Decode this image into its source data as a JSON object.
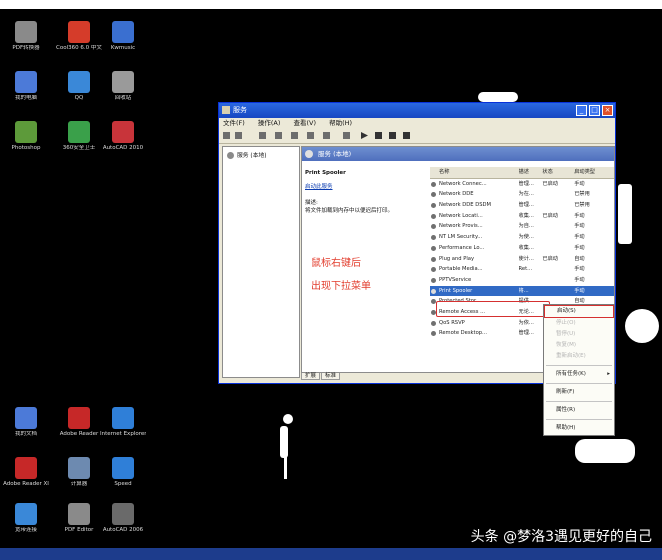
{
  "desktop_icons": [
    {
      "label": "PDF转换器",
      "color": "#8a8a8a"
    },
    {
      "label": "Cool360 6.0 中文版",
      "color": "#d53c2a"
    },
    {
      "label": "Kwmusic",
      "color": "#3a6fd0"
    },
    {
      "label": "我的电脑",
      "color": "#4c7ad8"
    },
    {
      "label": "QQ",
      "color": "#3a88d8"
    },
    {
      "label": "回收站",
      "color": "#9a9a9a"
    },
    {
      "label": "Photoshop",
      "color": "#5d9a3a"
    },
    {
      "label": "360安全卫士",
      "color": "#3aa04a"
    },
    {
      "label": "AutoCAD 2010",
      "color": "#c8343a"
    },
    {
      "label": "我的文档",
      "color": "#4c7ad8"
    },
    {
      "label": "Adobe Reader",
      "color": "#c62828"
    },
    {
      "label": "Internet Explorer",
      "color": "#2f7fd8"
    },
    {
      "label": "Adobe Reader XI",
      "color": "#c62828"
    },
    {
      "label": "计算器",
      "color": "#6d8ab0"
    },
    {
      "label": "Speed",
      "color": "#2f7fd8"
    },
    {
      "label": "宽带连接",
      "color": "#3a88d8"
    },
    {
      "label": "PDF Editor",
      "color": "#8a8a8a"
    },
    {
      "label": "AutoCAD 2006",
      "color": "#6a6a6a"
    }
  ],
  "window": {
    "title": "服务",
    "menu": [
      "文件(F)",
      "操作(A)",
      "查看(V)",
      "帮助(H)"
    ],
    "tree_item": "服务 (本地)",
    "header": "服务 (本地)",
    "selected_service": "Print Spooler",
    "description_link": "启动此服务",
    "description_label": "描述:",
    "description_text": "将文件加载到内存中以便迟后打印。",
    "columns": [
      "名称",
      "描述",
      "状态",
      "启动类型"
    ],
    "services": [
      {
        "name": "Network Connec...",
        "desc": "管理...",
        "status": "已启动",
        "startup": "手动"
      },
      {
        "name": "Network DDE",
        "desc": "为在...",
        "status": "",
        "startup": "已禁用"
      },
      {
        "name": "Network DDE DSDM",
        "desc": "管理...",
        "status": "",
        "startup": "已禁用"
      },
      {
        "name": "Network Locati...",
        "desc": "收集...",
        "status": "已启动",
        "startup": "手动"
      },
      {
        "name": "Network Provis...",
        "desc": "为自...",
        "status": "",
        "startup": "手动"
      },
      {
        "name": "NT LM Security...",
        "desc": "为使...",
        "status": "",
        "startup": "手动"
      },
      {
        "name": "Performance Lo...",
        "desc": "收集...",
        "status": "",
        "startup": "手动"
      },
      {
        "name": "Plug and Play",
        "desc": "使计...",
        "status": "已启动",
        "startup": "自动"
      },
      {
        "name": "Portable Media...",
        "desc": "Ret...",
        "status": "",
        "startup": "手动"
      },
      {
        "name": "PPTVService",
        "desc": "",
        "status": "",
        "startup": "手动"
      },
      {
        "name": "Print Spooler",
        "desc": "将...",
        "status": "",
        "startup": "手动"
      },
      {
        "name": "Protected Stor...",
        "desc": "提供...",
        "status": "",
        "startup": "自动"
      },
      {
        "name": "Remote Access ...",
        "desc": "无论...",
        "status": "",
        "startup": "手动"
      },
      {
        "name": "QoS RSVP",
        "desc": "为依...",
        "status": "",
        "startup": "手动"
      },
      {
        "name": "Remote Desktop...",
        "desc": "管理...",
        "status": "",
        "startup": "手动"
      }
    ],
    "tabs": [
      "扩展",
      "标准"
    ]
  },
  "annotation": {
    "line1": "鼠标右键后",
    "line2": "出现下拉菜单"
  },
  "context_menu": {
    "items": [
      "启动(S)",
      "停止(O)",
      "暂停(U)",
      "恢复(M)",
      "重新启动(E)",
      "所有任务(K)",
      "刷新(F)",
      "属性(R)",
      "帮助(H)"
    ],
    "submenu_arrow": "▸"
  },
  "watermark": "头条 @梦洛3遇见更好的自己"
}
